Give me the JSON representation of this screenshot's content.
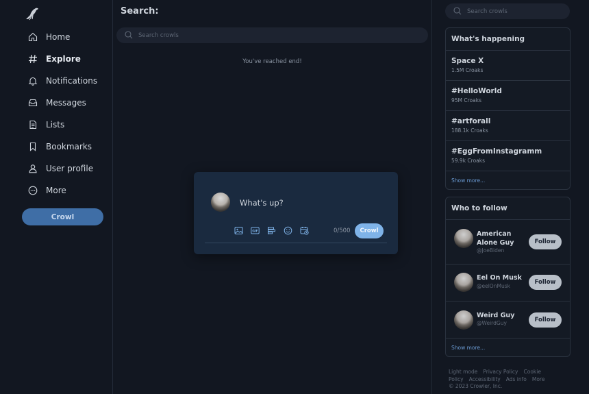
{
  "sidebar": {
    "items": [
      {
        "label": "Home",
        "icon": "home-icon"
      },
      {
        "label": "Explore",
        "icon": "hash-icon",
        "active": true
      },
      {
        "label": "Notifications",
        "icon": "bell-icon"
      },
      {
        "label": "Messages",
        "icon": "inbox-icon"
      },
      {
        "label": "Lists",
        "icon": "list-icon"
      },
      {
        "label": "Bookmarks",
        "icon": "bookmark-icon"
      },
      {
        "label": "User profile",
        "icon": "user-icon"
      },
      {
        "label": "More",
        "icon": "more-icon"
      }
    ],
    "crowl_button": "Crowl"
  },
  "main": {
    "title": "Search:",
    "search_placeholder": "Search crowls",
    "end_text": "You've reached end!"
  },
  "compose": {
    "placeholder": "What's up?",
    "tools": [
      "image-icon",
      "gif-icon",
      "poll-icon",
      "emoji-icon",
      "schedule-icon"
    ],
    "counter": "0/500",
    "submit": "Crowl"
  },
  "right": {
    "search_placeholder": "Search crowls",
    "happening": {
      "title": "What's happening",
      "trends": [
        {
          "name": "Space X",
          "count": "1.5M Croaks"
        },
        {
          "name": "#HelloWorld",
          "count": "95M Croaks"
        },
        {
          "name": "#artforall",
          "count": "188.1k Croaks"
        },
        {
          "name": "#EggFromInstagramm",
          "count": "59.9k Croaks"
        }
      ],
      "show_more": "Show more..."
    },
    "who_to_follow": {
      "title": "Who to follow",
      "users": [
        {
          "name": "American Alone Guy",
          "handle": "@JoeBiden",
          "follow": "Follow"
        },
        {
          "name": "Eel On Musk",
          "handle": "@eelOnMusk",
          "follow": "Follow"
        },
        {
          "name": "Weird Guy",
          "handle": "@WeirdGuy",
          "follow": "Follow"
        }
      ],
      "show_more": "Show more..."
    },
    "footer": {
      "links": [
        "Light mode",
        "Privacy Policy",
        "Cookie Policy",
        "Accessibility",
        "Ads info",
        "More"
      ],
      "copyright": "© 2023 Crowler, Inc."
    }
  },
  "colors": {
    "accent": "#7fb3e8",
    "crowl_button": "#3f6ea6",
    "background": "#121721",
    "compose_bg": "#1a2a3f"
  }
}
